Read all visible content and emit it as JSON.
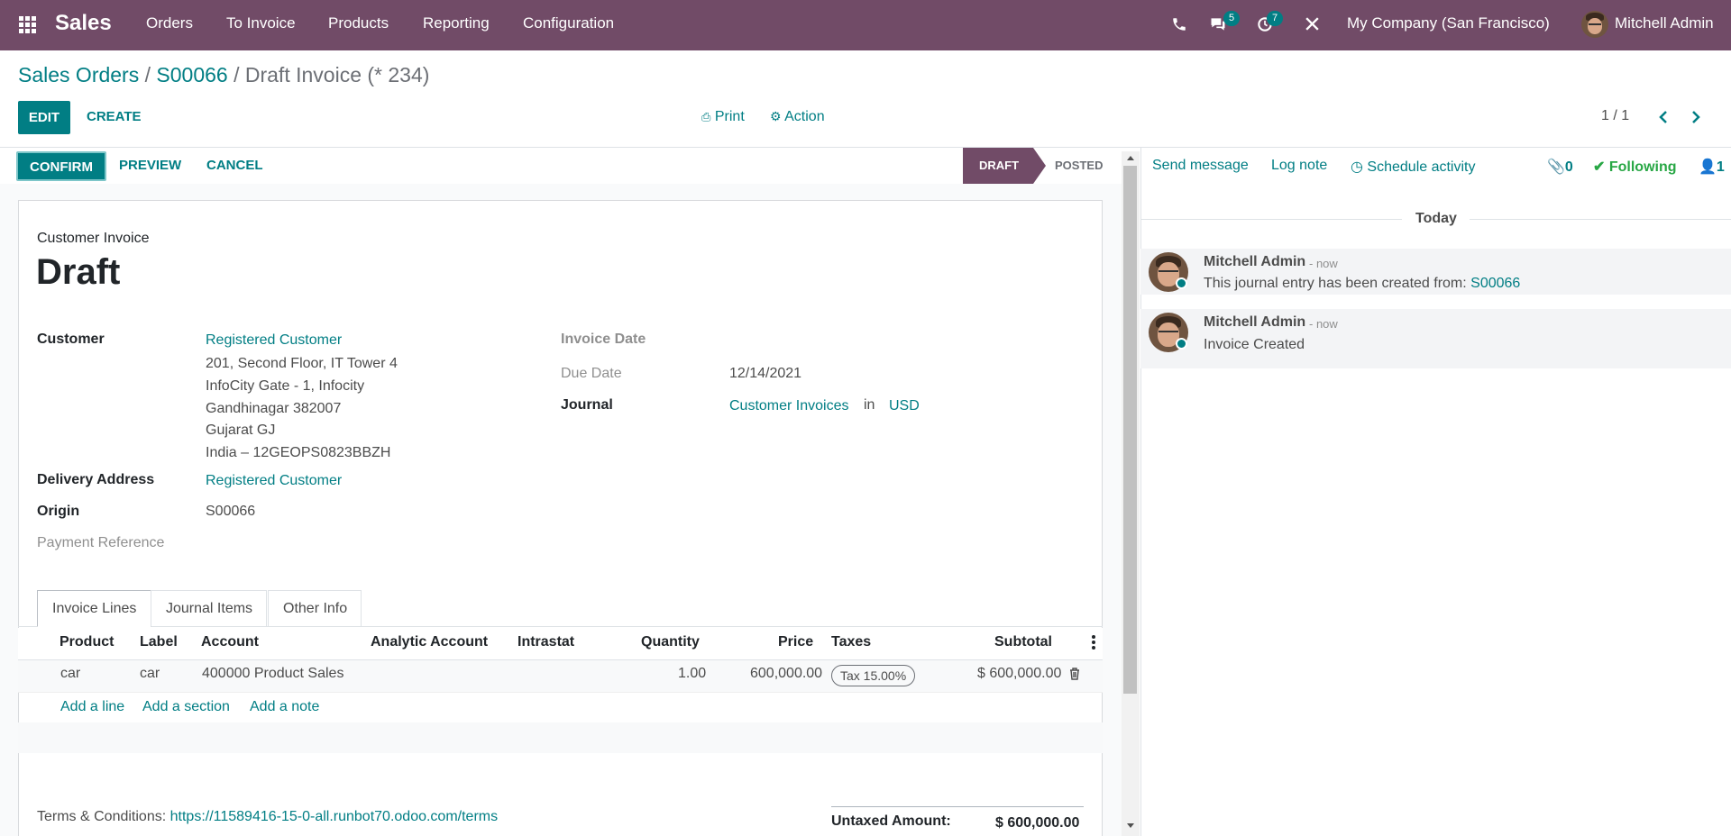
{
  "navbar": {
    "app_name": "Sales",
    "menus": [
      "Orders",
      "To Invoice",
      "Products",
      "Reporting",
      "Configuration"
    ],
    "messages_badge": "5",
    "activities_badge": "7",
    "company": "My Company (San Francisco)",
    "user": "Mitchell Admin",
    "color": "#714b67"
  },
  "breadcrumb": {
    "root": "Sales Orders",
    "sep1": "/",
    "order": "S00066",
    "sep2": "/",
    "current": "Draft Invoice (* 234)"
  },
  "control": {
    "edit": "EDIT",
    "create": "CREATE",
    "print": "Print",
    "action": "Action",
    "pager": "1 / 1"
  },
  "statusbar": {
    "confirm": "CONFIRM",
    "preview": "PREVIEW",
    "cancel": "CANCEL",
    "stages": [
      "DRAFT",
      "POSTED"
    ],
    "active_stage": "DRAFT"
  },
  "form": {
    "doc_type": "Customer Invoice",
    "state": "Draft",
    "customer_label": "Customer",
    "customer": "Registered Customer",
    "address": [
      "201, Second Floor, IT Tower 4",
      "InfoCity Gate - 1, Infocity",
      "Gandhinagar 382007",
      "Gujarat GJ",
      "India – 12GEOPS0823BBZH"
    ],
    "delivery_label": "Delivery Address",
    "delivery": "Registered Customer",
    "origin_label": "Origin",
    "origin": "S00066",
    "payment_ref_label": "Payment Reference",
    "invoice_date_label": "Invoice Date",
    "due_date_label": "Due Date",
    "due_date": "12/14/2021",
    "journal_label": "Journal",
    "journal": "Customer Invoices",
    "journal_in": "in",
    "currency": "USD"
  },
  "tabs": [
    "Invoice Lines",
    "Journal Items",
    "Other Info"
  ],
  "lines": {
    "columns": [
      "Product",
      "Label",
      "Account",
      "Analytic Account",
      "Intrastat",
      "Quantity",
      "Price",
      "Taxes",
      "Subtotal"
    ],
    "rows": [
      {
        "product": "car",
        "label": "car",
        "account": "400000 Product Sales",
        "analytic": "",
        "intrastat": "",
        "quantity": "1.00",
        "price": "600,000.00",
        "taxes": "Tax 15.00%",
        "subtotal": "$ 600,000.00"
      }
    ],
    "add_line": "Add a line",
    "add_section": "Add a section",
    "add_note": "Add a note"
  },
  "footer": {
    "terms_label": "Terms & Conditions:",
    "terms_link": "https://11589416-15-0-all.runbot70.odoo.com/terms",
    "untaxed_label": "Untaxed Amount:",
    "untaxed_value": "$ 600,000.00"
  },
  "chatter": {
    "send_message": "Send message",
    "log_note": "Log note",
    "schedule_activity": "Schedule activity",
    "attachments": "0",
    "following": "Following",
    "followers": "1",
    "date_separator": "Today",
    "messages": [
      {
        "author": "Mitchell Admin",
        "date": "- now",
        "body": "This journal entry has been created from:",
        "link": "S00066"
      },
      {
        "author": "Mitchell Admin",
        "date": "- now",
        "body": "Invoice Created",
        "link": ""
      }
    ]
  }
}
